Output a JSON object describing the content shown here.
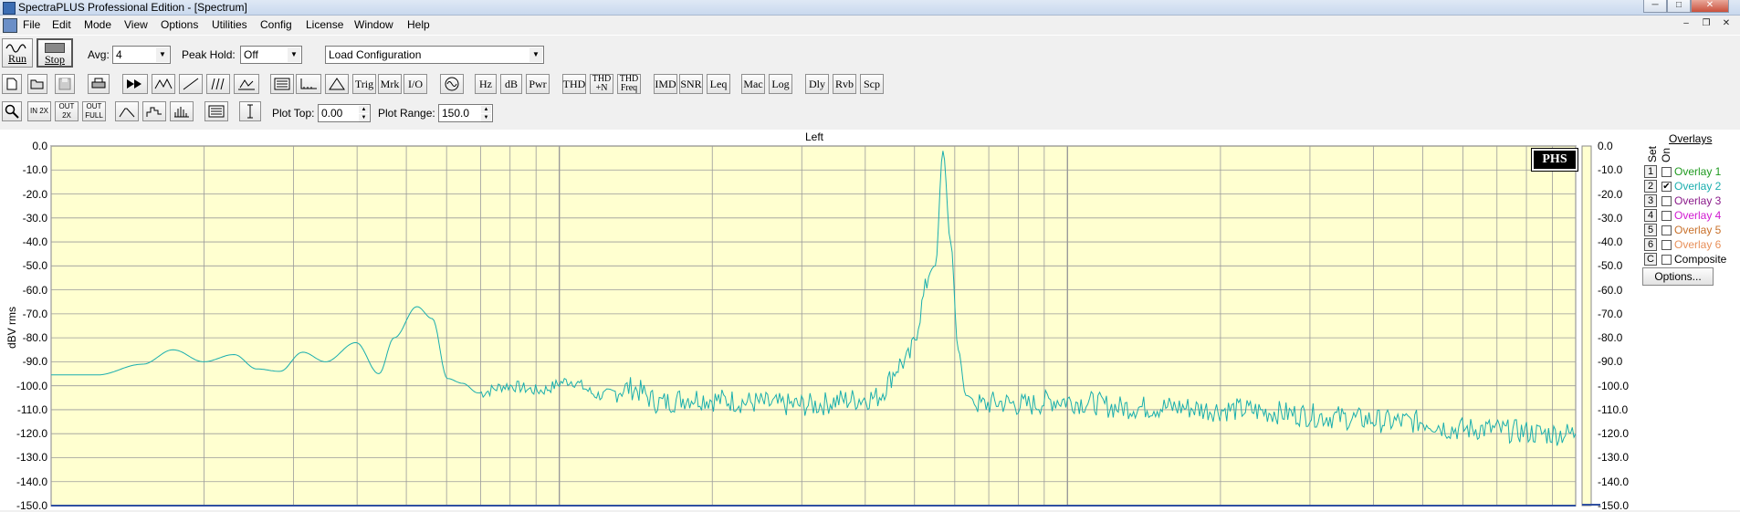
{
  "window": {
    "title": "SpectraPLUS Professional Edition - [Spectrum]",
    "minimize": "─",
    "maximize": "□",
    "close": "✕"
  },
  "menu": [
    "File",
    "Edit",
    "Mode",
    "View",
    "Options",
    "Utilities",
    "Config",
    "License",
    "Window",
    "Help"
  ],
  "mdi": {
    "minimize": "–",
    "restore": "❐",
    "close": "✕"
  },
  "toolbar1": {
    "run_label": "Run",
    "stop_label": "Stop",
    "avg_label": "Avg:",
    "avg_value": "4",
    "peak_hold_label": "Peak Hold:",
    "peak_hold_value": "Off",
    "config_value": "Load Configuration"
  },
  "toolbar2": {
    "text_buttons": [
      "Trig",
      "Mrk",
      "I/O",
      "Hz",
      "dB",
      "Pwr",
      "THD",
      "THD +N",
      "THD Freq",
      "IMD",
      "SNR",
      "Leq",
      "Mac",
      "Log",
      "Dly",
      "Rvb",
      "Scp"
    ]
  },
  "toolbar3": {
    "zoom_buttons": [
      "IN 2X",
      "OUT 2X",
      "OUT FULL"
    ],
    "plot_top_label": "Plot Top:",
    "plot_top_value": "0.00",
    "plot_range_label": "Plot Range:",
    "plot_range_value": "150.0"
  },
  "plot": {
    "title": "Left",
    "ylabel": "dBV rms",
    "badge": "PHS",
    "yticks": [
      "0.0",
      "-10.0",
      "-20.0",
      "-30.0",
      "-40.0",
      "-50.0",
      "-60.0",
      "-70.0",
      "-80.0",
      "-90.0",
      "-100.0",
      "-110.0",
      "-120.0",
      "-130.0",
      "-140.0",
      "-150.0"
    ],
    "colors": {
      "background": "#ffffd0",
      "grid": "#9a9a9a",
      "trace": "#1aaeae"
    }
  },
  "overlays": {
    "header": "Overlays",
    "set_label": "Set",
    "on_label": "On",
    "items": [
      {
        "num": "1",
        "label": "Overlay 1",
        "checked": false,
        "color": "#1f9a1f"
      },
      {
        "num": "2",
        "label": "Overlay 2",
        "checked": true,
        "color": "#1aaeae"
      },
      {
        "num": "3",
        "label": "Overlay 3",
        "checked": false,
        "color": "#8a1a8a"
      },
      {
        "num": "4",
        "label": "Overlay 4",
        "checked": false,
        "color": "#d11ad1"
      },
      {
        "num": "5",
        "label": "Overlay 5",
        "checked": false,
        "color": "#c8702a"
      },
      {
        "num": "6",
        "label": "Overlay 6",
        "checked": false,
        "color": "#e8905a"
      },
      {
        "num": "C",
        "label": "Composite",
        "checked": false,
        "color": "#000000"
      }
    ],
    "options_label": "Options..."
  },
  "chart_data": {
    "type": "line",
    "title": "Left",
    "xlabel": "",
    "ylabel": "dBV rms",
    "ylim": [
      -150,
      0
    ],
    "grid": true,
    "series": [
      {
        "x": [
          0,
          0.03,
          0.06,
          0.08,
          0.1,
          0.12,
          0.135,
          0.15,
          0.165,
          0.18,
          0.2,
          0.215,
          0.225,
          0.24,
          0.25,
          0.26,
          0.27,
          0.28,
          0.3,
          0.32,
          0.34,
          0.36,
          0.38,
          0.4,
          0.42,
          0.44,
          0.46,
          0.48,
          0.5,
          0.52,
          0.54,
          0.56,
          0.58,
          0.585,
          0.59,
          0.595,
          0.6,
          0.61,
          0.62,
          0.64,
          0.66,
          0.68,
          0.7,
          0.72,
          0.74,
          0.76,
          0.78,
          0.8,
          0.82,
          0.84,
          0.86,
          0.88,
          0.9,
          0.92,
          0.94,
          0.96,
          0.98,
          1.0
        ],
        "y": [
          -95.5,
          -95.5,
          -91,
          -85,
          -90,
          -87,
          -93,
          -94,
          -86,
          -90,
          -82,
          -95,
          -80,
          -67,
          -72,
          -97,
          -99,
          -103,
          -100,
          -102,
          -98,
          -104,
          -101,
          -107,
          -105,
          -106,
          -107,
          -108,
          -108,
          -106,
          -105,
          -90,
          -50,
          -2,
          -40,
          -85,
          -104,
          -108,
          -107,
          -108,
          -106,
          -107,
          -109,
          -109,
          -109,
          -110,
          -110,
          -111,
          -112,
          -113,
          -114,
          -115,
          -115,
          -118,
          -118,
          -119,
          -120,
          -120
        ]
      }
    ]
  }
}
